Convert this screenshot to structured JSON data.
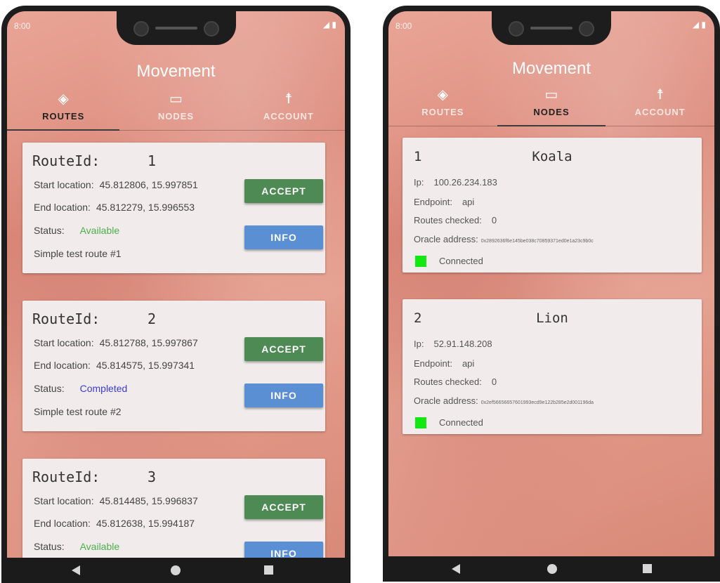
{
  "left_phone": {
    "status_time": "8:00",
    "app_title": "Movement",
    "tabs": [
      {
        "label": "ROUTES",
        "icon": "directions-icon"
      },
      {
        "label": "NODES",
        "icon": "laptop-icon"
      },
      {
        "label": "ACCOUNT",
        "icon": "person-icon"
      }
    ],
    "active_tab": "ROUTES",
    "routes": [
      {
        "title": "RouteId:",
        "id": "1",
        "start_label": "Start location:",
        "start": "45.812806, 15.997851",
        "end_label": "End location:",
        "end": "45.812279, 15.996553",
        "status_label": "Status:",
        "status": "Available",
        "description": "Simple test route #1",
        "accept_label": "ACCEPT",
        "info_label": "INFO"
      },
      {
        "title": "RouteId:",
        "id": "2",
        "start_label": "Start location:",
        "start": "45.812788, 15.997867",
        "end_label": "End location:",
        "end": "45.814575, 15.997341",
        "status_label": "Status:",
        "status": "Completed",
        "description": "Simple test route #2",
        "accept_label": "ACCEPT",
        "info_label": "INFO"
      },
      {
        "title": "RouteId:",
        "id": "3",
        "start_label": "Start location:",
        "start": "45.814485, 15.996837",
        "end_label": "End location:",
        "end": "45.812638, 15.994187",
        "status_label": "Status:",
        "status": "Available",
        "accept_label": "ACCEPT",
        "info_label": "INFO"
      }
    ]
  },
  "right_phone": {
    "status_time": "8:00",
    "app_title": "Movement",
    "tabs": [
      {
        "label": "ROUTES",
        "icon": "directions-icon"
      },
      {
        "label": "NODES",
        "icon": "laptop-icon"
      },
      {
        "label": "ACCOUNT",
        "icon": "person-icon"
      }
    ],
    "active_tab": "NODES",
    "nodes": [
      {
        "num": "1",
        "name": "Koala",
        "ip_label": "Ip:",
        "ip": "100.26.234.183",
        "endpoint_label": "Endpoint:",
        "endpoint": "api",
        "routes_label": "Routes checked:",
        "routes_checked": "0",
        "oracle_label": "Oracle address:",
        "oracle": "0x2892636f6e145be038c70859371ed0e1a23c9b0c",
        "connection": "Connected"
      },
      {
        "num": "2",
        "name": "Lion",
        "ip_label": "Ip:",
        "ip": "52.91.148.208",
        "endpoint_label": "Endpoint:",
        "endpoint": "api",
        "routes_label": "Routes checked:",
        "routes_checked": "0",
        "oracle_label": "Oracle address:",
        "oracle": "0x2ef56656657601993ecd9e122b285e2d001196da",
        "connection": "Connected"
      }
    ]
  },
  "colors": {
    "accept": "#4e8a53",
    "info": "#5a8fd4",
    "available": "#4cae4c",
    "completed": "#3b3bd6",
    "connected": "#11e911"
  }
}
